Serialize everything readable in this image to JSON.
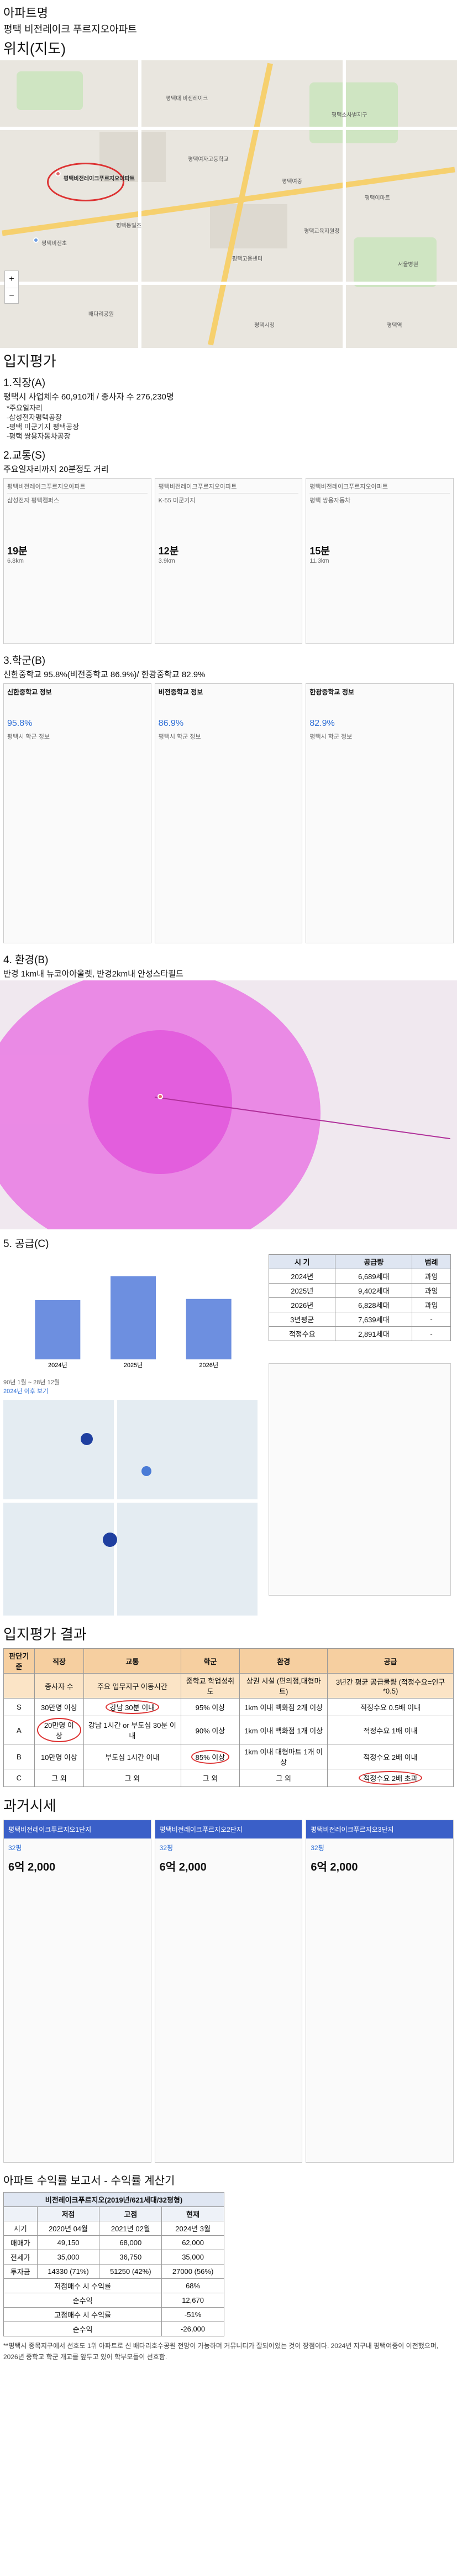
{
  "header": {
    "label": "아파트명",
    "apartment_name": "평택 비전레이크 푸르지오아파트"
  },
  "location": {
    "title": "위치(지도)",
    "pois": [
      "평택비전레이크푸르지오아파트",
      "평택비전초",
      "평택대 비젠레이크",
      "평택여자고등학교",
      "평택동일초",
      "평택여중",
      "평택고용센터",
      "평택교육지원청",
      "평택소사벌지구",
      "평택이마트",
      "서울병원",
      "배다리공원",
      "평택시청",
      "평택역"
    ]
  },
  "evaluation": {
    "title": "입지평가",
    "job": {
      "title": "1.직장(A)",
      "line": "평택시 사업체수 60,910개 / 종사자 수 276,230명",
      "note": "*주요일자리",
      "bullets": [
        "-삼성전자평택공장",
        "-평택 미군기지 평택공장",
        "-평택 쌍용자동차공장"
      ]
    },
    "traffic": {
      "title": "2.교통(S)",
      "line": "주요일자리까지 20분정도 거리",
      "origin": "평택비전레이크푸르지오아파트",
      "destinations": [
        "삼성전자 평택캠퍼스",
        "K-55 미군기지",
        "평택 쌍용자동차"
      ],
      "times": [
        {
          "min": "19분",
          "dist": "6.8km"
        },
        {
          "min": "12분",
          "dist": "3.9km"
        },
        {
          "min": "15분",
          "dist": "11.3km"
        }
      ]
    },
    "school": {
      "title": "3.학군(B)",
      "line": "신한중학교 95.8%(비전중학교 86.9%)/ 한광중학교 82.9%",
      "schools": [
        {
          "name": "신한중학교 정보",
          "rate": "95.8%"
        },
        {
          "name": "비전중학교 정보",
          "rate": "86.9%"
        },
        {
          "name": "한광중학교 정보",
          "rate": "82.9%"
        }
      ],
      "panel_sub": "평택시 학군 정보"
    },
    "env": {
      "title": "4. 환경(B)",
      "line": "반경 1km내 뉴코아아울렛, 반경2km내 안성스타필드"
    },
    "supply": {
      "title": "5. 공급(C)",
      "table_headers": [
        "시 기",
        "공급량",
        "범례"
      ],
      "rows": [
        {
          "year": "2024년",
          "amount": "6,689세대",
          "legend": "과잉"
        },
        {
          "year": "2025년",
          "amount": "9,402세대",
          "legend": "과잉"
        },
        {
          "year": "2026년",
          "amount": "6,828세대",
          "legend": "과잉"
        },
        {
          "year": "3년평균",
          "amount": "7,639세대",
          "legend": "-"
        },
        {
          "year": "적정수요",
          "amount": "2,891세대",
          "legend": "-"
        }
      ],
      "chart_note": "2024년 이후 보기",
      "axis_start": "90년 1월 ~ 28년 12월"
    }
  },
  "result": {
    "title": "입지평가 결과",
    "columns": [
      "판단기준",
      "직장",
      "교통",
      "학군",
      "환경",
      "공급"
    ],
    "sub_columns": [
      "",
      "종사자 수",
      "주요 업무지구 이동시간",
      "중학교 학업성취도",
      "상권 시설 (편의점,대형마트)",
      "3년간 평균 공급물량 (적정수요=인구*0.5)"
    ],
    "rows": [
      {
        "grade": "S",
        "job": "30만명 이상",
        "traffic": "강남 30분 이내",
        "school": "95% 이상",
        "env": "1km 이내 백화점 2개 이상",
        "supply": "적정수요 0.5배 이내"
      },
      {
        "grade": "A",
        "job": "20만명 이상",
        "traffic": "강남 1시간 or 부도심 30분 이내",
        "school": "90% 이상",
        "env": "1km 이내 백화점 1개 이상",
        "supply": "적정수요 1배 이내"
      },
      {
        "grade": "B",
        "job": "10만명 이상",
        "traffic": "부도심 1시간 이내",
        "school": "85% 이상",
        "env": "1km 이내 대형마트 1개 이상",
        "supply": "적정수요 2배 이내"
      },
      {
        "grade": "C",
        "job": "그 외",
        "traffic": "그 외",
        "school": "그 외",
        "env": "그 외",
        "supply": "적정수요 2배 초과"
      }
    ]
  },
  "price": {
    "title": "과거시세",
    "cards": [
      {
        "name": "평택비전레이크푸르지오1단지",
        "area": "32평",
        "price": "6억 2,000"
      },
      {
        "name": "평택비전레이크푸르지오2단지",
        "area": "32평",
        "price": "6억 2,000"
      },
      {
        "name": "평택비전레이크푸르지오3단지",
        "area": "32평",
        "price": "6억 2,000"
      }
    ]
  },
  "report": {
    "title": "아파트 수익률 보고서 - 수익률 계산기",
    "sub": "비전레이크푸르지오(2019년/621세대/32평형)",
    "headers": [
      "",
      "저점",
      "고점",
      "현재"
    ],
    "rows": [
      {
        "label": "시기",
        "low": "2020년 04월",
        "high": "2021년 02월",
        "now": "2024년 3월"
      },
      {
        "label": "매매가",
        "low": "49,150",
        "high": "68,000",
        "now": "62,000"
      },
      {
        "label": "전세가",
        "low": "35,000",
        "high": "36,750",
        "now": "35,000"
      },
      {
        "label": "투자금",
        "low": "14330 (71%)",
        "high": "51250 (42%)",
        "now": "27000 (56%)"
      }
    ],
    "summary": [
      {
        "label": "저점매수 시 수익률",
        "value": "68%"
      },
      {
        "label": "순수익",
        "value": "12,670"
      },
      {
        "label": "고점매수 시 수익률",
        "value": "-51%"
      },
      {
        "label": "순수익",
        "value": "-26,000"
      }
    ],
    "footnote": "**평택시 종목지구에서 선호도 1위 아파트로 신 배다리호수공원 전망이 가능하며 커뮤니티가 잘되어있는 것이 장점이다. 2024년 지구내 평택여중이 이전했으며, 2026년 중학교 학군 개교를 앞두고 있어 학부모들이 선호함."
  },
  "chart_data": {
    "type": "bar",
    "title": "",
    "categories": [
      "2024년",
      "2025년",
      "2026년"
    ],
    "values": [
      6689,
      9402,
      6828
    ],
    "ylim": [
      0,
      10000
    ]
  }
}
